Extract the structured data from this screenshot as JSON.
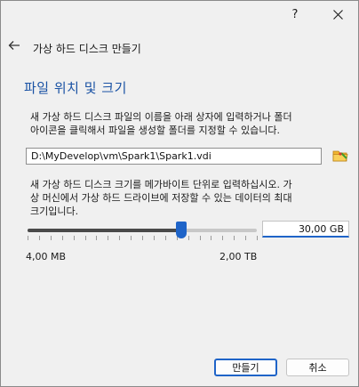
{
  "window": {
    "help_label": "?"
  },
  "header": {
    "title": "가상 하드 디스크 만들기"
  },
  "section": {
    "title": "파일 위치 및 크기"
  },
  "location": {
    "description_lines": [
      "새 가상 하드 디스크 파일의 이름을 아래 상자에 입력하거나 폴더",
      "아이콘을 클릭해서 파일을 생성할 폴더를 지정할 수 있습니다."
    ],
    "path_value": "D:\\MyDevelop\\vm\\Spark1\\Spark1.vdi"
  },
  "size": {
    "description_lines": [
      "새 가상 하드 디스크 크기를 메가바이트 단위로 입력하십시오. 가",
      "상 머신에서 가상 하드 드라이브에 저장할 수 있는 데이터의 최대",
      "크기입니다."
    ],
    "value": "30,00 GB",
    "min_label": "4,00 MB",
    "max_label": "2,00 TB",
    "slider_fraction": 0.67
  },
  "buttons": {
    "create": "만들기",
    "cancel": "취소"
  },
  "colors": {
    "accent": "#1f64c8",
    "title": "#1a52a4"
  },
  "icons": {
    "back": "arrow-left-icon",
    "folder": "folder-icon",
    "close": "close-icon"
  }
}
